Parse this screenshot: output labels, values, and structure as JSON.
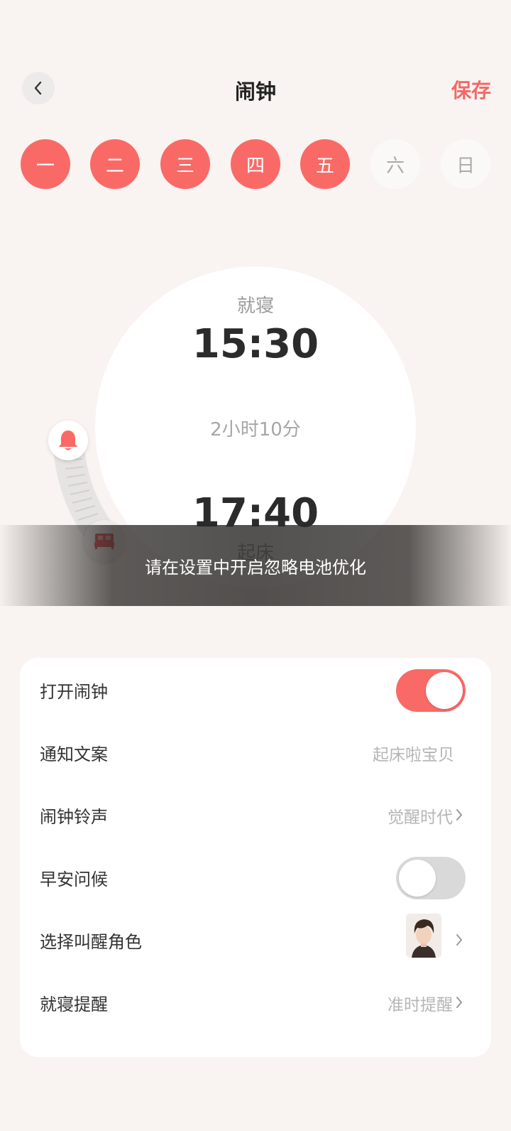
{
  "header": {
    "title": "闹钟",
    "save_label": "保存"
  },
  "days": [
    {
      "label": "一",
      "selected": true
    },
    {
      "label": "二",
      "selected": true
    },
    {
      "label": "三",
      "selected": true
    },
    {
      "label": "四",
      "selected": true
    },
    {
      "label": "五",
      "selected": true
    },
    {
      "label": "六",
      "selected": false
    },
    {
      "label": "日",
      "selected": false
    }
  ],
  "dial": {
    "bedtime_label": "就寝",
    "bedtime": "15:30",
    "duration": "2小时10分",
    "wake_time": "17:40",
    "wake_label": "起床"
  },
  "toast": "请在设置中开启忽略电池优化",
  "settings": {
    "alarm_on": {
      "label": "打开闹钟",
      "enabled": true
    },
    "notify_text": {
      "label": "通知文案",
      "value": "起床啦宝贝"
    },
    "ringtone": {
      "label": "闹钟铃声",
      "value": "觉醒时代"
    },
    "greeting": {
      "label": "早安问候",
      "enabled": false
    },
    "role": {
      "label": "选择叫醒角色"
    },
    "bedtime_reminder": {
      "label": "就寝提醒",
      "value": "准时提醒"
    }
  },
  "colors": {
    "accent": "#f96a67",
    "background": "#f9f3f1"
  }
}
